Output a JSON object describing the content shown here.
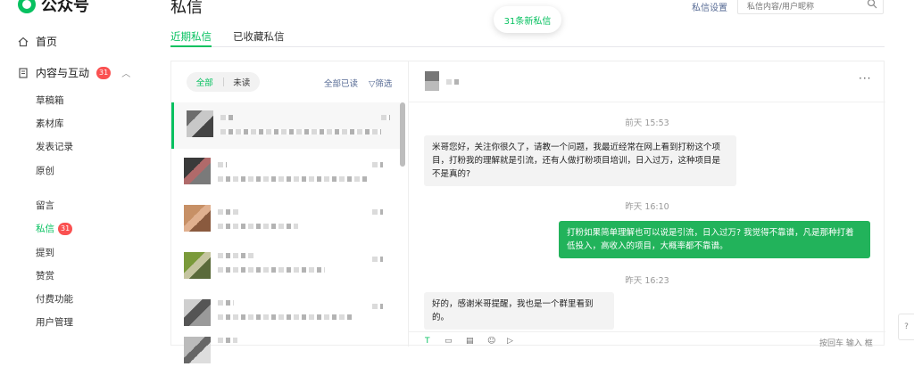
{
  "brand": {
    "name": "公众号",
    "accent": "#07c160"
  },
  "sidebar": {
    "home": {
      "label": "首页",
      "icon": "home-icon"
    },
    "content_group": {
      "label": "内容与互动",
      "badge": "31",
      "icon": "document-icon"
    },
    "content_items": [
      "草稿箱",
      "素材库",
      "发表记录",
      "原创"
    ],
    "interaction_items": [
      {
        "label": "留言"
      },
      {
        "label": "私信",
        "badge": "31",
        "active": true
      },
      {
        "label": "提到"
      },
      {
        "label": "赞赏"
      },
      {
        "label": "付费功能"
      },
      {
        "label": "用户管理"
      }
    ]
  },
  "header": {
    "title": "私信",
    "new_message_pill": "31条新私信",
    "settings_link": "私信设置",
    "search_placeholder": "私信内容/用户昵称"
  },
  "tabs": [
    {
      "label": "近期私信",
      "active": true
    },
    {
      "label": "已收藏私信",
      "active": false
    }
  ],
  "list": {
    "filter_all": "全部",
    "filter_unread": "未读",
    "mark_all_read": "全部已读",
    "filter_button": "筛选"
  },
  "chat": {
    "more_icon": "more-icon",
    "messages": [
      {
        "time": "前天 15:53",
        "direction": "in",
        "text": "米哥您好，关注你很久了，请教一个问题，我最近经常在网上看到打粉这个项目，打粉我的理解就是引流，还有人做打粉项目培训，日入过万，这种项目是不是真的?"
      },
      {
        "time": "昨天 16:10",
        "direction": "out",
        "text": "打粉如果简单理解也可以说是引流，日入过万? 我觉得不靠谱，凡是那种打着低投入，高收入的项目，大概率都不靠谱。"
      },
      {
        "time": "昨天 16:23",
        "direction": "in",
        "text": "好的，感谢米哥提醒，我也是一个群里看到的。"
      }
    ],
    "composer_hint": "按回车 输入 框"
  }
}
